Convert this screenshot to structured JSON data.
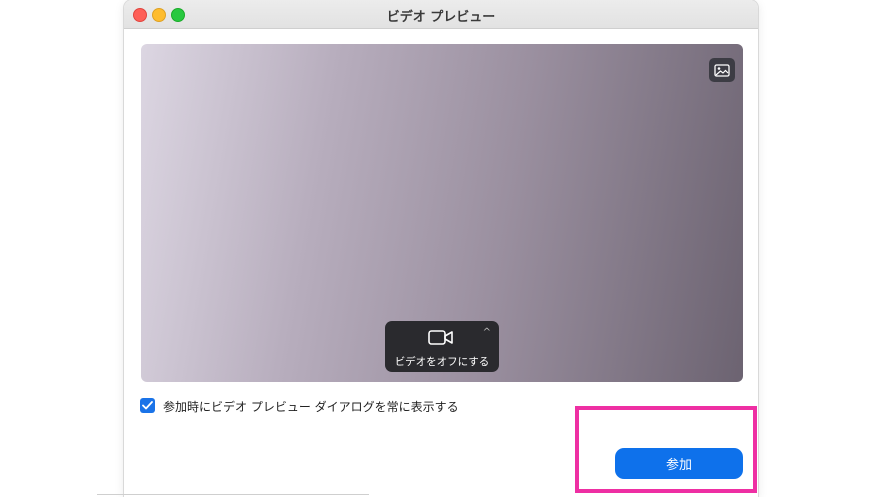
{
  "window": {
    "title": "ビデオ プレビュー"
  },
  "preview": {
    "background_button_icon": "image-icon",
    "camera_control": {
      "icon": "video-camera-icon",
      "caret_icon": "chevron-up-icon",
      "label": "ビデオをオフにする"
    }
  },
  "options": {
    "always_show_preview": {
      "checked": true,
      "label": "参加時にビデオ プレビュー ダイアログを常に表示する"
    }
  },
  "actions": {
    "join_label": "参加"
  },
  "colors": {
    "accent": "#0e71eb",
    "highlight": "#ee2fa3"
  }
}
